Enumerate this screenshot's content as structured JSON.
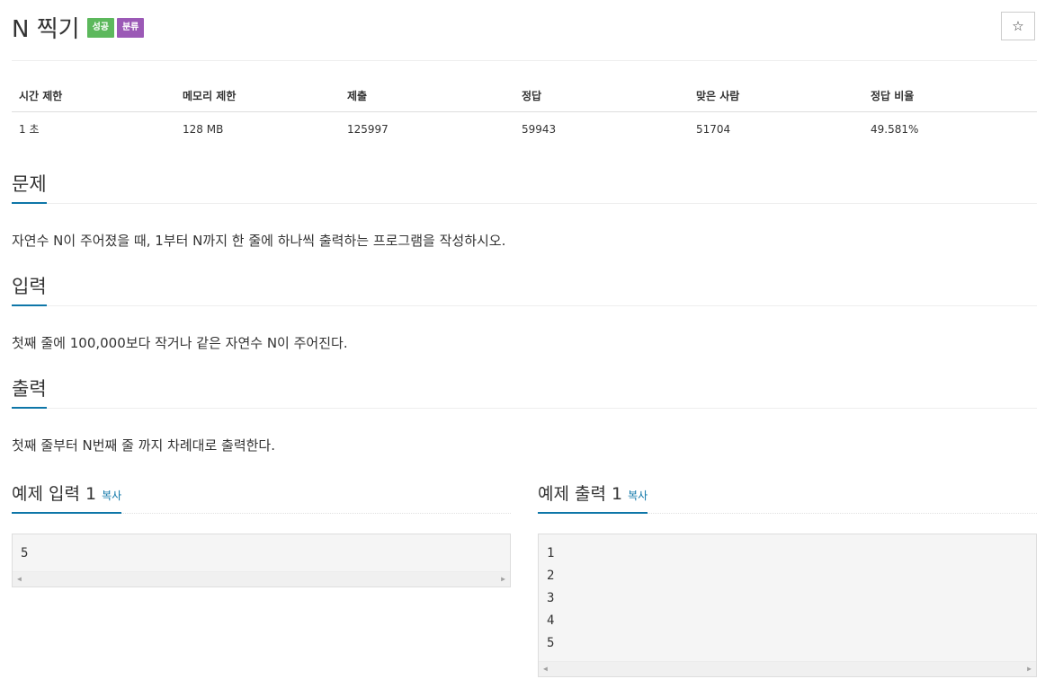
{
  "header": {
    "title": "N 찍기",
    "badges": {
      "success": "성공",
      "category": "분류"
    },
    "star_icon": "☆"
  },
  "info": {
    "headers": [
      "시간 제한",
      "메모리 제한",
      "제출",
      "정답",
      "맞은 사람",
      "정답 비율"
    ],
    "values": [
      "1 초",
      "128 MB",
      "125997",
      "59943",
      "51704",
      "49.581%"
    ]
  },
  "sections": {
    "problem": {
      "title": "문제",
      "text": "자연수 N이 주어졌을 때, 1부터 N까지 한 줄에 하나씩 출력하는 프로그램을 작성하시오."
    },
    "input": {
      "title": "입력",
      "text": "첫째 줄에 100,000보다 작거나 같은 자연수 N이 주어진다."
    },
    "output": {
      "title": "출력",
      "text": "첫째 줄부터 N번째 줄 까지 차례대로 출력한다."
    }
  },
  "samples": {
    "input": {
      "title": "예제 입력 1",
      "copy": "복사",
      "lines": [
        "5"
      ]
    },
    "output": {
      "title": "예제 출력 1",
      "copy": "복사",
      "lines": [
        "1",
        "2",
        "3",
        "4",
        "5"
      ]
    }
  },
  "colors": {
    "accent": "#0e76a8",
    "success": "#5cb85c",
    "category": "#9b59b6"
  }
}
